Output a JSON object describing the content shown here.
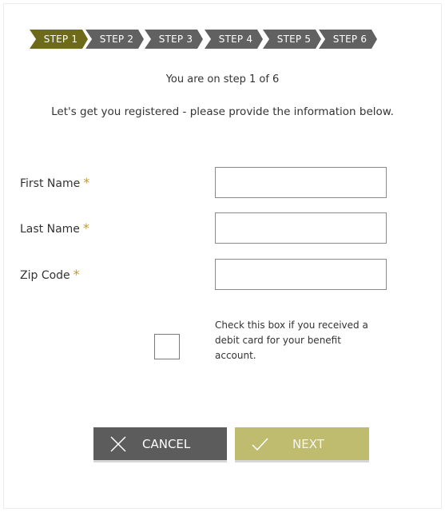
{
  "stepper": {
    "steps": [
      {
        "label": "STEP 1",
        "active": true
      },
      {
        "label": "STEP 2",
        "active": false
      },
      {
        "label": "STEP 3",
        "active": false
      },
      {
        "label": "STEP 4",
        "active": false
      },
      {
        "label": "STEP 5",
        "active": false
      },
      {
        "label": "STEP 6",
        "active": false
      }
    ],
    "status": "You are on step 1 of 6"
  },
  "intro": "Let's get you registered - please provide the information below.",
  "form": {
    "required_marker": "*",
    "first_name": {
      "label": "First Name",
      "value": ""
    },
    "last_name": {
      "label": "Last Name",
      "value": ""
    },
    "zip_code": {
      "label": "Zip Code",
      "value": ""
    },
    "debit_card": {
      "label": "Check this box if you received a debit card for your benefit account.",
      "checked": false
    }
  },
  "buttons": {
    "cancel": "CANCEL",
    "next": "NEXT"
  },
  "colors": {
    "active_step": "#6d6b1a",
    "inactive_step": "#616161",
    "required": "#c49a2a",
    "cancel_bg": "#5c5c5c",
    "next_bg": "#bfbb6f"
  },
  "icons": {
    "cancel": "close-icon",
    "next": "checkmark-icon"
  }
}
